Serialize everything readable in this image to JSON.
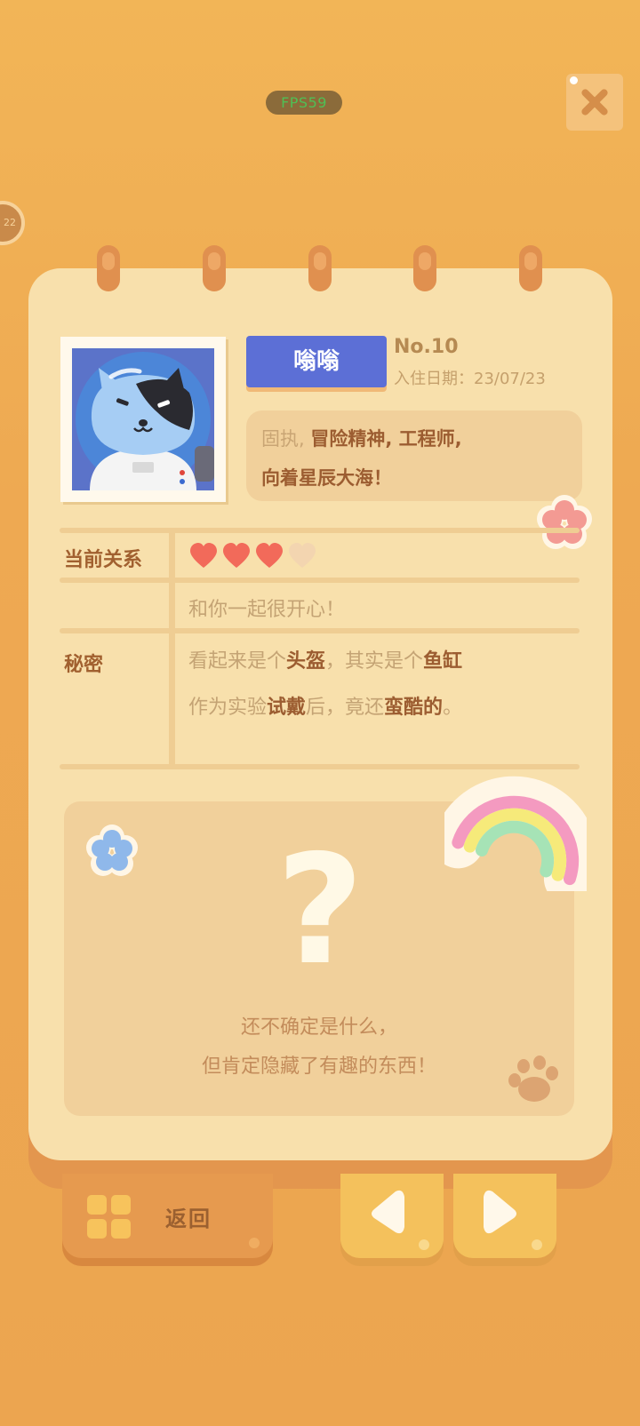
{
  "status": {
    "fps_label": "FPS59"
  },
  "side_badge": {
    "text": "22"
  },
  "profile": {
    "name": "嗡嗡",
    "number": "No.10",
    "move_in_date": "入住日期：23/07/23",
    "traits_prefix": "固执, ",
    "traits_bold": "冒险精神, 工程师,",
    "motto": "向着星辰大海！"
  },
  "table": {
    "relation_label": "当前关系",
    "hearts_filled": 3,
    "hearts_total": 4,
    "relation_note": "和你一起很开心！",
    "secret_label": "秘密",
    "secret_line1_a": "看起来是个",
    "secret_line1_b": "头盔",
    "secret_line1_c": "，其实是个",
    "secret_line1_d": "鱼缸",
    "secret_line2_a": "作为实验",
    "secret_line2_b": "试戴",
    "secret_line2_c": "后，竟还",
    "secret_line2_d": "蛮酷的",
    "secret_line2_e": "。"
  },
  "mystery": {
    "mark": "?",
    "line1": "还不确定是什么，",
    "line2": "但肯定隐藏了有趣的东西！"
  },
  "buttons": {
    "back_label": "返回"
  },
  "colors": {
    "name_tag": "#5c6fd6",
    "heart": "#f26a5a",
    "heart_empty": "#f3d5b0"
  }
}
